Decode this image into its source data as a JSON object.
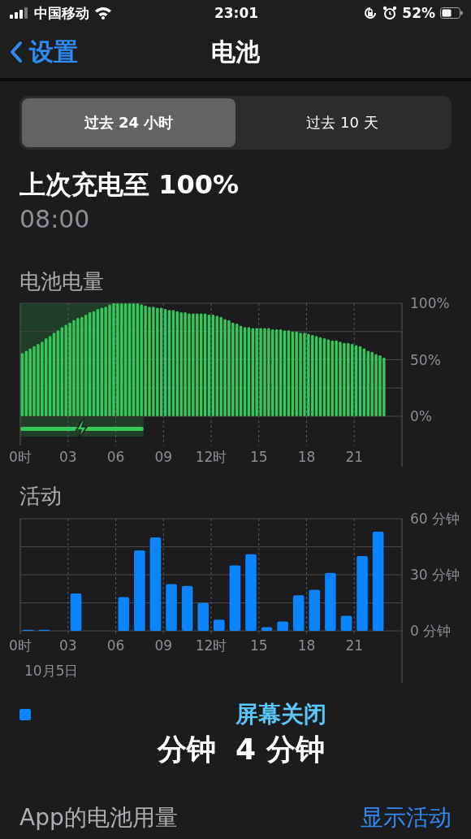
{
  "status_bar": {
    "carrier": "中国移动",
    "time": "23:01",
    "battery_percent": "52%"
  },
  "nav": {
    "back_label": "设置",
    "title": "电池"
  },
  "segments": [
    {
      "label": "过去 24 小时",
      "selected": true
    },
    {
      "label": "过去 10 天",
      "selected": false
    }
  ],
  "last_charge": {
    "title": "上次充电至 100%",
    "time": "08:00"
  },
  "battery_level": {
    "chart_data": {
      "type": "bar",
      "title": "电池电量",
      "xlim": [
        0,
        24
      ],
      "ylim": [
        0,
        100
      ],
      "x": [
        0.125,
        0.375,
        0.625,
        0.875,
        1.125,
        1.375,
        1.625,
        1.875,
        2.125,
        2.375,
        2.625,
        2.875,
        3.125,
        3.375,
        3.625,
        3.875,
        4.125,
        4.375,
        4.625,
        4.875,
        5.125,
        5.375,
        5.625,
        5.875,
        6.125,
        6.375,
        6.625,
        6.875,
        7.125,
        7.375,
        7.625,
        7.875,
        8.125,
        8.375,
        8.625,
        8.875,
        9.125,
        9.375,
        9.625,
        9.875,
        10.125,
        10.375,
        10.625,
        10.875,
        11.125,
        11.375,
        11.625,
        11.875,
        12.125,
        12.375,
        12.625,
        12.875,
        13.125,
        13.375,
        13.625,
        13.875,
        14.125,
        14.375,
        14.625,
        14.875,
        15.125,
        15.375,
        15.625,
        15.875,
        16.125,
        16.375,
        16.625,
        16.875,
        17.125,
        17.375,
        17.625,
        17.875,
        18.125,
        18.375,
        18.625,
        18.875,
        19.125,
        19.375,
        19.625,
        19.875,
        20.125,
        20.375,
        20.625,
        20.875,
        21.125,
        21.375,
        21.625,
        21.875,
        22.125,
        22.375,
        22.625,
        22.875
      ],
      "xticks": [
        {
          "value": 0,
          "label": "0时"
        },
        {
          "value": 3,
          "label": "03"
        },
        {
          "value": 6,
          "label": "06"
        },
        {
          "value": 9,
          "label": "09"
        },
        {
          "value": 12,
          "label": "12时"
        },
        {
          "value": 15,
          "label": "15"
        },
        {
          "value": 18,
          "label": "18"
        },
        {
          "value": 21,
          "label": "21"
        }
      ],
      "yticks": [
        {
          "value": 0,
          "label": "0%"
        },
        {
          "value": 50,
          "label": "50%"
        },
        {
          "value": 100,
          "label": "100%"
        }
      ],
      "series": [
        {
          "color": "#34c759",
          "values": [
            56,
            58,
            60,
            62,
            64,
            66,
            69,
            71,
            74,
            76,
            79,
            81,
            83,
            85,
            87,
            88,
            90,
            92,
            93,
            95,
            96,
            97,
            99,
            100,
            100,
            100,
            100,
            100,
            100,
            100,
            99,
            98,
            97,
            97,
            96,
            96,
            95,
            94,
            94,
            93,
            92,
            92,
            91,
            91,
            91,
            91,
            91,
            90,
            90,
            89,
            88,
            86,
            85,
            83,
            82,
            80,
            79,
            79,
            78,
            78,
            78,
            78,
            78,
            77,
            77,
            77,
            76,
            76,
            75,
            75,
            74,
            74,
            73,
            72,
            71,
            70,
            69,
            68,
            67,
            67,
            66,
            65,
            65,
            64,
            63,
            62,
            60,
            58,
            57,
            55,
            54,
            52
          ]
        }
      ],
      "bands": [
        {
          "axis": "x",
          "from": 0,
          "to": 7.75
        }
      ],
      "grid": true
    }
  },
  "activity": {
    "date": "10月5日",
    "chart_data": {
      "type": "bar",
      "title": "活动",
      "xlim": [
        0,
        24
      ],
      "ylim": [
        0,
        60
      ],
      "x": [
        0.5,
        1.5,
        3.5,
        6.5,
        7.5,
        8.5,
        9.5,
        10.5,
        11.5,
        12.5,
        13.5,
        14.5,
        15.5,
        16.5,
        17.5,
        18.5,
        19.5,
        20.5,
        21.5,
        22.5
      ],
      "xticks": [
        {
          "value": 0,
          "label": "0时"
        },
        {
          "value": 3,
          "label": "03"
        },
        {
          "value": 6,
          "label": "06"
        },
        {
          "value": 9,
          "label": "09"
        },
        {
          "value": 12,
          "label": "12时"
        },
        {
          "value": 15,
          "label": "15"
        },
        {
          "value": 18,
          "label": "18"
        },
        {
          "value": 21,
          "label": "21"
        }
      ],
      "yticks": [
        {
          "value": 0,
          "label": "0 分钟"
        },
        {
          "value": 30,
          "label": "30 分钟"
        },
        {
          "value": 60,
          "label": "60 分钟"
        }
      ],
      "series": [
        {
          "color": "#0a84ff",
          "values": [
            0.5,
            0.5,
            20,
            18,
            43,
            50,
            25,
            24,
            15,
            6,
            35,
            41,
            2,
            5,
            19,
            22,
            31,
            8,
            40,
            53
          ]
        }
      ],
      "grid": true
    }
  },
  "screen_time": {
    "on_value": "分钟",
    "off_label": "屏幕关闭",
    "off_value": "4 分钟"
  },
  "app_usage": {
    "title": "App的电池用量",
    "link": "显示活动"
  }
}
